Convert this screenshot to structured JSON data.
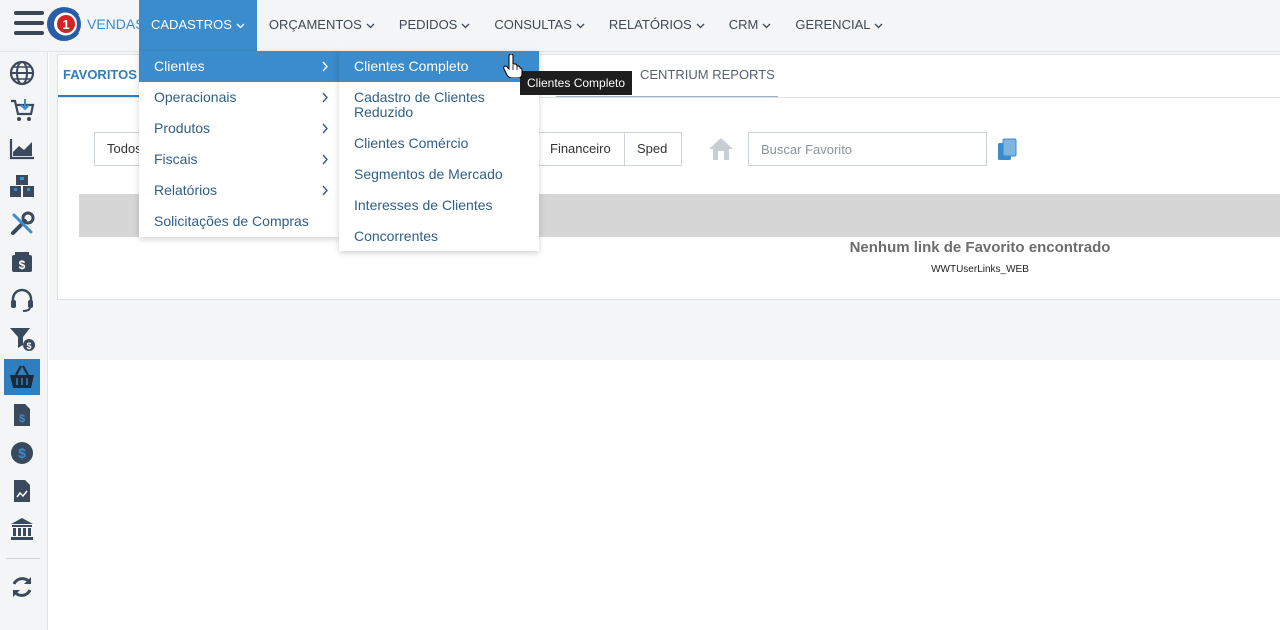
{
  "app": {
    "name": "VENDAS"
  },
  "nav": [
    {
      "label": "CADASTROS",
      "active": true
    },
    {
      "label": "ORÇAMENTOS"
    },
    {
      "label": "PEDIDOS"
    },
    {
      "label": "CONSULTAS"
    },
    {
      "label": "RELATÓRIOS"
    },
    {
      "label": "CRM"
    },
    {
      "label": "GERENCIAL"
    }
  ],
  "sidebar": {
    "icons": [
      "globe-icon",
      "cart-download-icon",
      "chart-icon",
      "boxes-icon",
      "tools-icon",
      "money-box-icon",
      "headset-icon",
      "funnel-dollar-icon",
      "basket-icon",
      "invoice-dollar-icon",
      "dollar-circle-icon",
      "document-chart-icon",
      "bank-icon",
      "refresh-icon"
    ],
    "active_icon": "basket-icon"
  },
  "tabs": {
    "favoritos": "FAVORITOS",
    "centrium": "CENTRIUM REPORTS"
  },
  "filters": {
    "todos": "Todos",
    "financeiro": "Financeiro",
    "sped": "Sped"
  },
  "search": {
    "placeholder": "Buscar Favorito",
    "value": ""
  },
  "grid": {
    "empty_message": "Nenhum link de Favorito encontrado",
    "empty_sub": "WWTUserLinks_WEB"
  },
  "menu_cadastros": [
    {
      "label": "Clientes",
      "submenu": true,
      "highlighted": true
    },
    {
      "label": "Operacionais",
      "submenu": true
    },
    {
      "label": "Produtos",
      "submenu": true
    },
    {
      "label": "Fiscais",
      "submenu": true
    },
    {
      "label": "Relatórios",
      "submenu": true
    },
    {
      "label": "Solicitações de Compras",
      "submenu": false
    }
  ],
  "menu_clientes": [
    {
      "label": "Clientes Completo",
      "highlighted": true
    },
    {
      "label": "Cadastro de Clientes Reduzido"
    },
    {
      "label": "Clientes Comércio"
    },
    {
      "label": "Segmentos de Mercado"
    },
    {
      "label": "Interesses de Clientes"
    },
    {
      "label": "Concorrentes"
    }
  ],
  "tooltip": "Clientes Completo",
  "colors": {
    "accent": "#3b8ccc",
    "sidebar_active": "#2f7fc0",
    "icon": "#3a4a5c"
  }
}
